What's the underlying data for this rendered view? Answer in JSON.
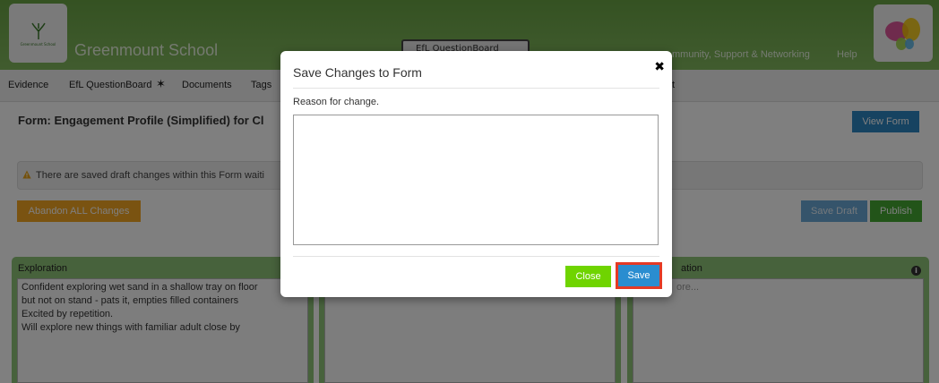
{
  "header": {
    "school_name": "Greenmount School",
    "logo_text": "Greenmount School",
    "center_tab": "EfL QuestionBoard",
    "nav": {
      "community": "mmunity, Support & Networking",
      "help": "Help"
    }
  },
  "subnav": {
    "items": [
      {
        "label": "Evidence"
      },
      {
        "label": "EfL QuestionBoard"
      },
      {
        "label": "Documents"
      },
      {
        "label": "Tags"
      }
    ],
    "hidden_tail": "t"
  },
  "page": {
    "form_title": "Form: Engagement Profile (Simplified) for Cl",
    "view_form_label": "View Form",
    "warning_text": "There are saved draft changes within this Form waiti",
    "abandon_label": "Abandon ALL Changes",
    "save_draft_label": "Save Draft",
    "publish_label": "Publish"
  },
  "panels": [
    {
      "title": "Exploration",
      "lines": [
        "Confident exploring wet sand in a shallow tray on floor",
        "but not on stand - pats it, empties filled containers",
        "Excited by repetition.",
        "Will explore new things with familiar adult close by"
      ]
    },
    {
      "title": "",
      "lines": []
    },
    {
      "title": "ation",
      "placeholder": "ore..."
    }
  ],
  "modal": {
    "title": "Save Changes to Form",
    "close_icon": "✖",
    "reason_label": "Reason for change.",
    "reason_value": "",
    "close_label": "Close",
    "save_label": "Save"
  },
  "colors": {
    "header_green": "#6aa445",
    "save_button": "#2a8dd0",
    "close_button": "#6fd400",
    "highlight_border": "#e53a25",
    "abandon_button": "#f5a623",
    "publish_button": "#44a832"
  }
}
